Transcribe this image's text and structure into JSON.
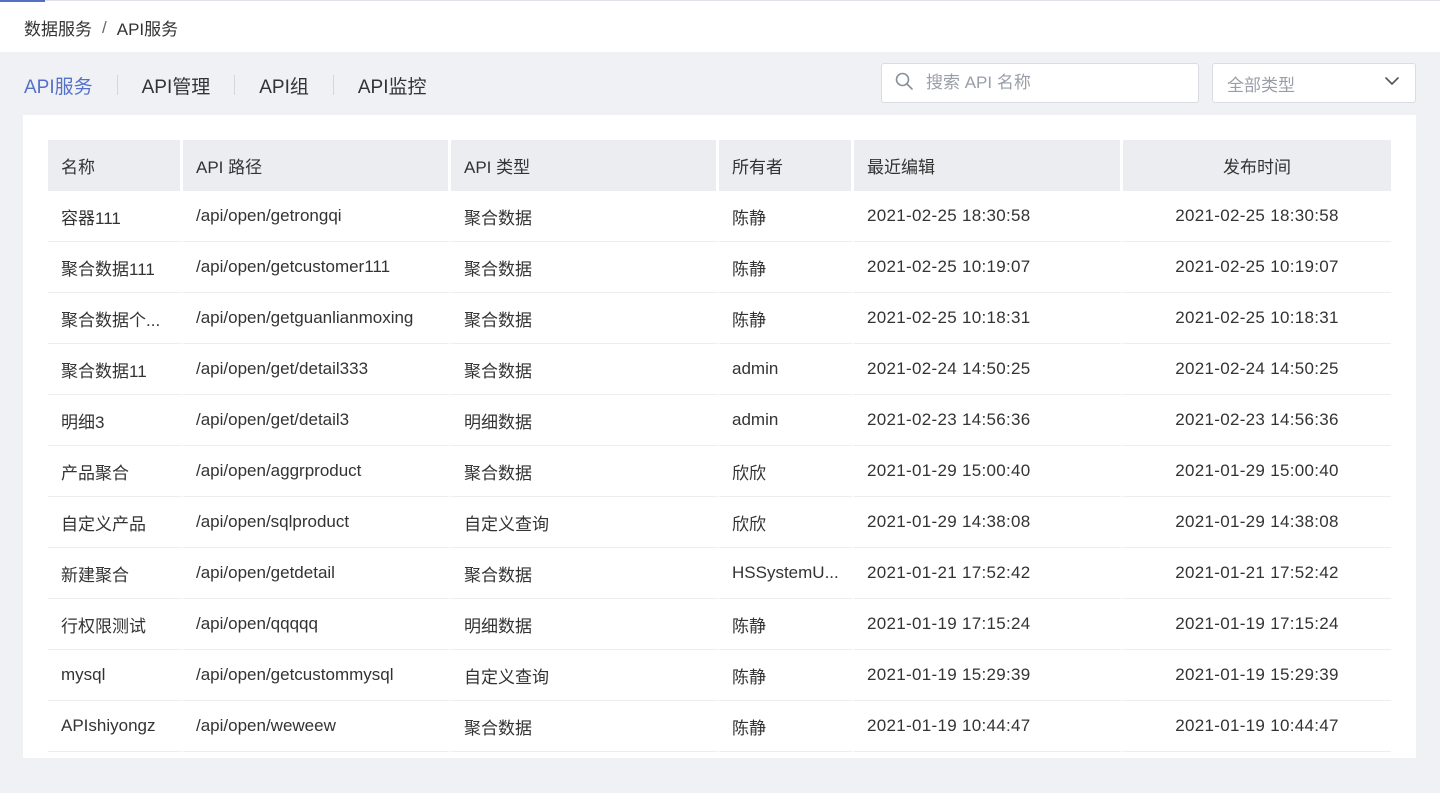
{
  "breadcrumb": {
    "root": "数据服务",
    "separator": "/",
    "current": "API服务"
  },
  "tabs": [
    {
      "label": "API服务",
      "active": true
    },
    {
      "label": "API管理",
      "active": false
    },
    {
      "label": "API组",
      "active": false
    },
    {
      "label": "API监控",
      "active": false
    }
  ],
  "search": {
    "placeholder": "搜索 API 名称",
    "value": ""
  },
  "type_filter": {
    "selected": "全部类型"
  },
  "colors": {
    "accent": "#5570c8",
    "header_bg": "#ebedf0",
    "page_bg": "#f0f1f5"
  },
  "table": {
    "headers": [
      "名称",
      "API 路径",
      "API 类型",
      "所有者",
      "最近编辑",
      "发布时间"
    ],
    "rows": [
      [
        "容器111",
        "/api/open/getrongqi",
        "聚合数据",
        "陈静",
        "2021-02-25 18:30:58",
        "2021-02-25 18:30:58"
      ],
      [
        "聚合数据111",
        "/api/open/getcustomer111",
        "聚合数据",
        "陈静",
        "2021-02-25 10:19:07",
        "2021-02-25 10:19:07"
      ],
      [
        "聚合数据个...",
        "/api/open/getguanlianmoxing",
        "聚合数据",
        "陈静",
        "2021-02-25 10:18:31",
        "2021-02-25 10:18:31"
      ],
      [
        "聚合数据11",
        "/api/open/get/detail333",
        "聚合数据",
        "admin",
        "2021-02-24 14:50:25",
        "2021-02-24 14:50:25"
      ],
      [
        "明细3",
        "/api/open/get/detail3",
        "明细数据",
        "admin",
        "2021-02-23 14:56:36",
        "2021-02-23 14:56:36"
      ],
      [
        "产品聚合",
        "/api/open/aggrproduct",
        "聚合数据",
        "欣欣",
        "2021-01-29 15:00:40",
        "2021-01-29 15:00:40"
      ],
      [
        "自定义产品",
        "/api/open/sqlproduct",
        "自定义查询",
        "欣欣",
        "2021-01-29 14:38:08",
        "2021-01-29 14:38:08"
      ],
      [
        "新建聚合",
        "/api/open/getdetail",
        "聚合数据",
        "HSSystemU...",
        "2021-01-21 17:52:42",
        "2021-01-21 17:52:42"
      ],
      [
        "行权限测试",
        "/api/open/qqqqq",
        "明细数据",
        "陈静",
        "2021-01-19 17:15:24",
        "2021-01-19 17:15:24"
      ],
      [
        "mysql",
        "/api/open/getcustommysql",
        "自定义查询",
        "陈静",
        "2021-01-19 15:29:39",
        "2021-01-19 15:29:39"
      ],
      [
        "APIshiyongz",
        "/api/open/weweew",
        "聚合数据",
        "陈静",
        "2021-01-19 10:44:47",
        "2021-01-19 10:44:47"
      ]
    ]
  }
}
